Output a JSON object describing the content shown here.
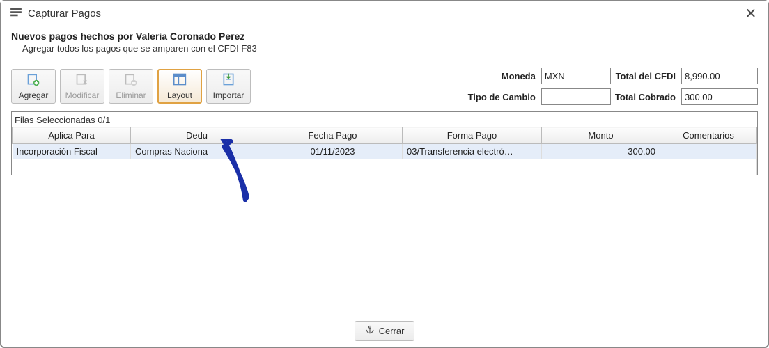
{
  "window": {
    "title": "Capturar Pagos"
  },
  "header": {
    "line1": "Nuevos pagos hechos por Valeria Coronado Perez",
    "line2": "Agregar todos los pagos que se amparen con el CFDI F83"
  },
  "toolbar": {
    "agregar": "Agregar",
    "modificar": "Modificar",
    "eliminar": "Eliminar",
    "layout": "Layout",
    "importar": "Importar"
  },
  "fields": {
    "moneda_label": "Moneda",
    "moneda_value": "MXN",
    "tipo_cambio_label": "Tipo de Cambio",
    "tipo_cambio_value": "",
    "total_cfdi_label": "Total del CFDI",
    "total_cfdi_value": "8,990.00",
    "total_cobrado_label": "Total Cobrado",
    "total_cobrado_value": "300.00"
  },
  "table": {
    "selection_label": "Filas Seleccionadas  0/1",
    "headers": {
      "aplica_para": "Aplica Para",
      "dedu": "Dedu",
      "fecha_pago": "Fecha Pago",
      "forma_pago": "Forma Pago",
      "monto": "Monto",
      "comentarios": "Comentarios"
    },
    "rows": [
      {
        "aplica_para": "Incorporación Fiscal",
        "dedu": "Compras Naciona",
        "fecha_pago": "01/11/2023",
        "forma_pago": "03/Transferencia electró…",
        "monto": "300.00",
        "comentarios": ""
      }
    ]
  },
  "footer": {
    "cerrar": "Cerrar"
  }
}
